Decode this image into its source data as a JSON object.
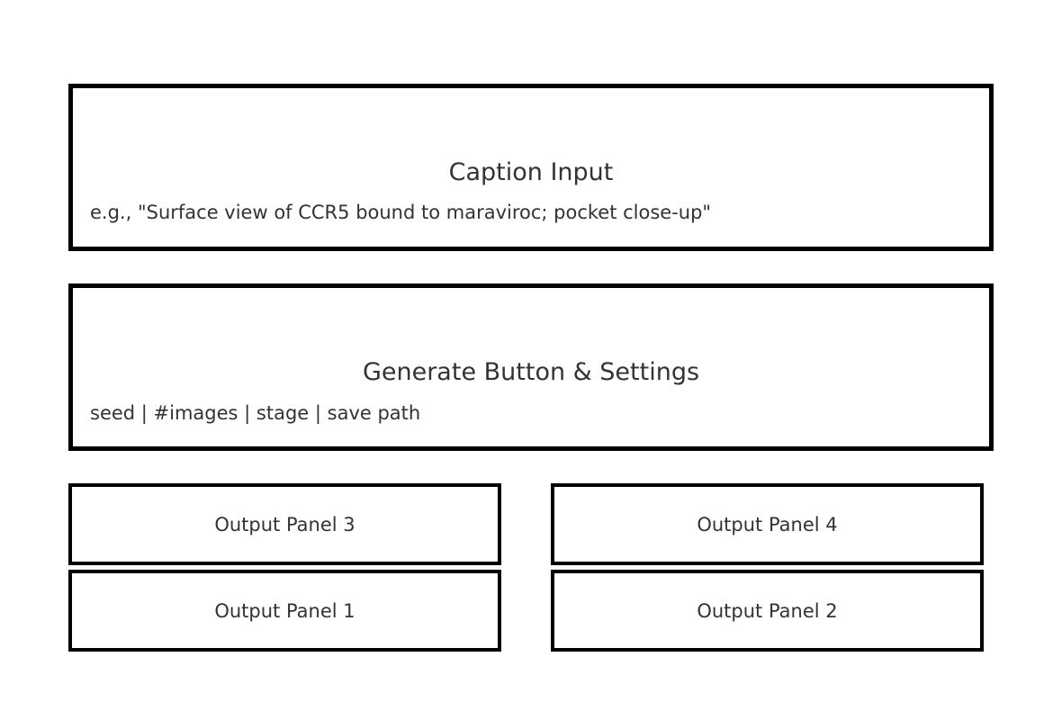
{
  "caption_input": {
    "title": "Caption Input",
    "placeholder_text": "e.g., \"Surface view of CCR5 bound to maraviroc; pocket close-up\""
  },
  "generate_settings": {
    "title": "Generate Button & Settings",
    "settings_text": "seed | #images | stage | save path"
  },
  "output_panels": {
    "panel_1": "Output Panel 1",
    "panel_2": "Output Panel 2",
    "panel_3": "Output Panel 3",
    "panel_4": "Output Panel 4"
  }
}
